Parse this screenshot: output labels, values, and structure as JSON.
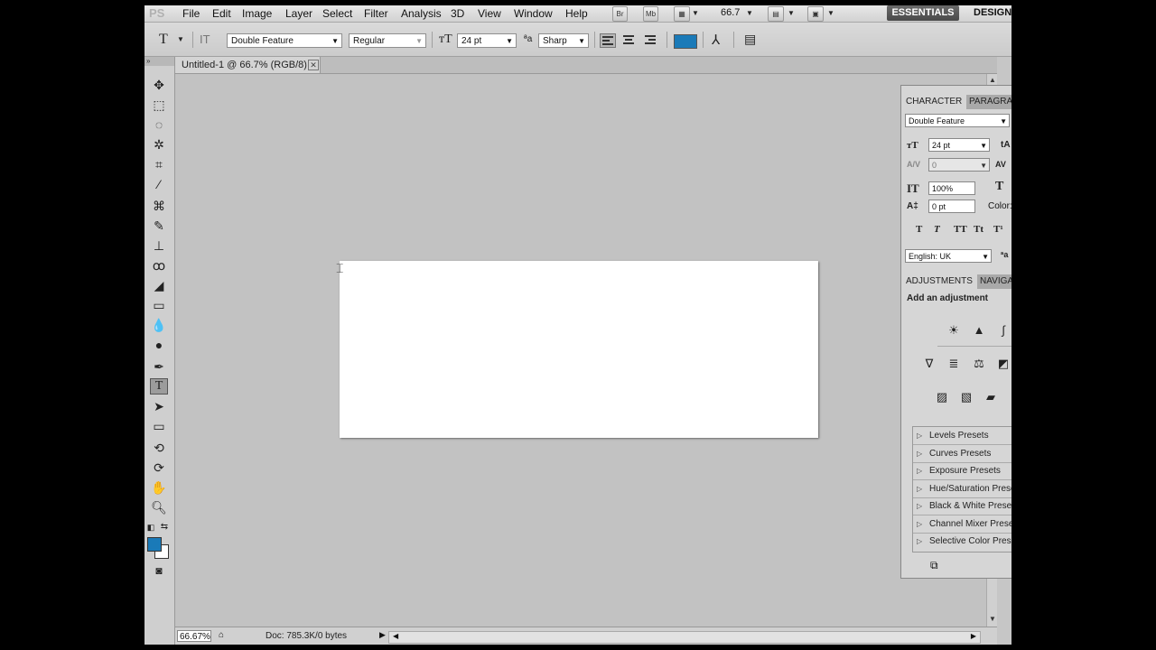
{
  "app": {
    "logo": "PS"
  },
  "menu": [
    "File",
    "Edit",
    "Image",
    "Layer",
    "Select",
    "Filter",
    "Analysis",
    "3D",
    "View",
    "Window",
    "Help"
  ],
  "menubar": {
    "bridge_label": "Br",
    "minibridge_label": "Mb",
    "zoom": "66.7",
    "workspace_active": "ESSENTIALS",
    "workspace_other": "DESIGN"
  },
  "options": {
    "font_family": "Double Feature",
    "font_style": "Regular",
    "font_size": "24 pt",
    "antialias_icon": "aa",
    "antialias": "Sharp"
  },
  "document": {
    "tab_title": "Untitled-1 @ 66.7% (RGB/8)"
  },
  "status": {
    "zoom": "66.67%",
    "doc_info": "Doc: 785.3K/0 bytes"
  },
  "character": {
    "tab_active": "CHARACTER",
    "tab_other": "PARAGRA",
    "font_family": "Double Feature",
    "font_size": "24 pt",
    "kerning": "0",
    "vertical_scale": "100%",
    "baseline_shift": "0 pt",
    "color_label": "Color:",
    "language": "English: UK",
    "style_buttons": [
      "T",
      "T",
      "TT",
      "Tt",
      "T¹"
    ]
  },
  "adjustments": {
    "tab_active": "ADJUSTMENTS",
    "tab_other": "NAVIGA",
    "heading": "Add an adjustment",
    "presets": [
      "Levels Presets",
      "Curves Presets",
      "Exposure Presets",
      "Hue/Saturation Presets",
      "Black & White Presets",
      "Channel Mixer Presets",
      "Selective Color Presets"
    ]
  },
  "colors": {
    "foreground": "#1a7ab8",
    "background": "#ffffff"
  }
}
